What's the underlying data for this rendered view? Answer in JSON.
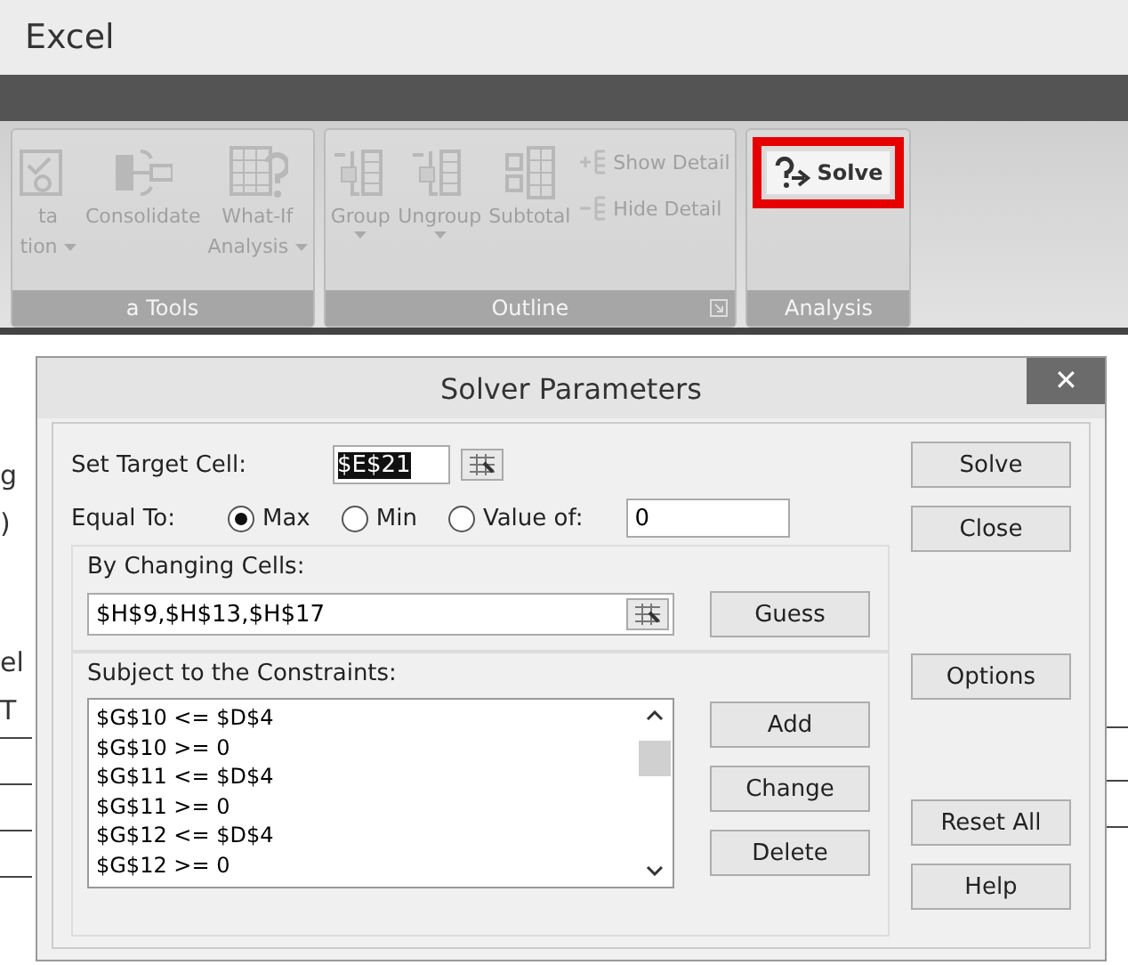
{
  "window": {
    "title": "Excel"
  },
  "ribbon": {
    "groups": [
      {
        "label": "a Tools",
        "launcher": false,
        "items": [
          {
            "kind": "large",
            "lines": [
              "ta",
              "tion"
            ],
            "dropdown": true,
            "highlighted": false
          },
          {
            "kind": "large",
            "lines": [
              "Consolidate"
            ],
            "dropdown": false,
            "highlighted": false
          },
          {
            "kind": "large",
            "lines": [
              "What-If",
              "Analysis"
            ],
            "dropdown": true,
            "highlighted": false
          }
        ]
      },
      {
        "label": "Outline",
        "launcher": true,
        "items": [
          {
            "kind": "large",
            "lines": [
              "Group"
            ],
            "dropdown": true,
            "highlighted": false
          },
          {
            "kind": "large",
            "lines": [
              "Ungroup"
            ],
            "dropdown": true,
            "highlighted": false
          },
          {
            "kind": "large",
            "lines": [
              "Subtotal"
            ],
            "dropdown": false,
            "highlighted": false
          },
          {
            "kind": "small",
            "lines": [
              "Show Detail",
              "Hide Detail"
            ],
            "dropdown": false,
            "highlighted": false
          }
        ]
      },
      {
        "label": "Analysis",
        "launcher": false,
        "items": [
          {
            "kind": "solver",
            "lines": [
              "Solve"
            ],
            "dropdown": false,
            "highlighted": true
          }
        ]
      }
    ]
  },
  "sheet_fragments": [
    "g",
    ")",
    "el",
    "T"
  ],
  "dialog": {
    "title": "Solver Parameters",
    "close": "✕",
    "target_cell": {
      "label": "Set Target Cell:",
      "value": "$E$21",
      "selected": true
    },
    "equal_to": {
      "label": "Equal To:",
      "options": [
        {
          "label": "Max",
          "selected": true
        },
        {
          "label": "Min",
          "selected": false
        },
        {
          "label": "Value of:",
          "selected": false
        }
      ],
      "value": "0"
    },
    "changing_cells": {
      "label": "By Changing Cells:",
      "value": "$H$9,$H$13,$H$17",
      "button": "Guess"
    },
    "constraints": {
      "label": "Subject to the Constraints:",
      "items": [
        "$G$10 <= $D$4",
        "$G$10 >= 0",
        "$G$11 <= $D$4",
        "$G$11 >= 0",
        "$G$12 <= $D$4",
        "$G$12 >= 0"
      ],
      "buttons": [
        "Add",
        "Change",
        "Delete"
      ]
    },
    "buttons": [
      "Solve",
      "Close",
      "Options",
      "Reset All",
      "Help"
    ]
  }
}
